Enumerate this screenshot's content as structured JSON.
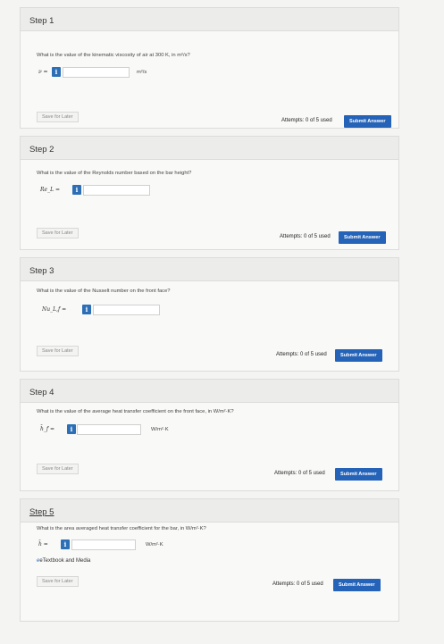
{
  "steps": [
    {
      "title": "Step 1",
      "question": "What is the value of the kinematic viscosity of air at 300 K, in m²/s?",
      "var_label": "ν =",
      "unit": "m²/s",
      "save_label": "Save for Later",
      "attempts": "Attempts: 0 of 5 used",
      "submit_label": "Submit Answer"
    },
    {
      "title": "Step 2",
      "question": "What is the value of the Reynolds number based on the bar height?",
      "var_label": "Re_L =",
      "unit": "",
      "save_label": "Save for Later",
      "attempts": "Attempts: 0 of 5 used",
      "submit_label": "Submit Answer"
    },
    {
      "title": "Step 3",
      "question": "What is the value of the Nusselt number on the front face?",
      "var_label": "Nu_L,f =",
      "unit": "",
      "save_label": "Save for Later",
      "attempts": "Attempts: 0 of 5 used",
      "submit_label": "Submit Answer"
    },
    {
      "title": "Step 4",
      "question": "What is the value of the average heat transfer coefficient on the front face, in W/m²·K?",
      "var_label": "h̄_f =",
      "unit": "W/m²·K",
      "save_label": "Save for Later",
      "attempts": "Attempts: 0 of 5 used",
      "submit_label": "Submit Answer"
    },
    {
      "title": "Step 5",
      "question": "What is the area averaged heat transfer coefficient for the bar, in W/m²·K?",
      "var_label": "h̄ =",
      "unit": "W/m²·K",
      "save_label": "Save for Later",
      "attempts": "Attempts: 0 of 5 used",
      "submit_label": "Submit Answer",
      "ebook_label": "eTextbook and Media"
    }
  ],
  "info_glyph": "i",
  "colors": {
    "accent": "#2563b8",
    "info": "#2c6fb7"
  }
}
